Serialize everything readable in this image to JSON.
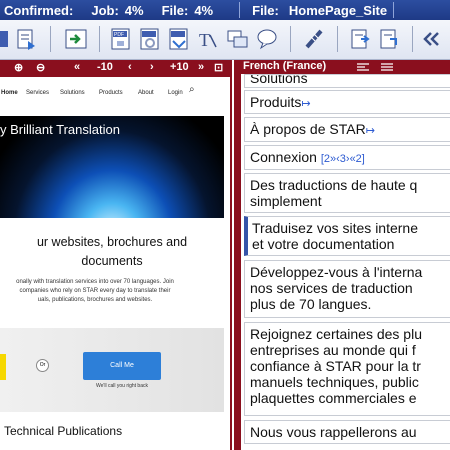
{
  "status": {
    "confirmed_label": "Confirmed:",
    "job_label": "Job:",
    "job_value": "4%",
    "file_label": "File:",
    "file_value": "4%",
    "file_name_label": "File:",
    "file_name": "HomePage_Site"
  },
  "toolbar": {
    "buttons": [
      "save-doc",
      "next-segment",
      "pdf-export",
      "pdf-refresh",
      "pdf-preview",
      "text-format",
      "copy-text",
      "comment",
      "ruler-tool",
      "confirm-next",
      "confirm-down",
      "rewind"
    ]
  },
  "preview": {
    "nav": {
      "zoom_in": "⊕",
      "zoom_out": "⊖",
      "first": "«",
      "minus10": "-10",
      "prev": "‹",
      "next": "›",
      "plus10": "+10",
      "last": "»",
      "fit": "⊡"
    },
    "site_nav": [
      "Home",
      "Services",
      "Solutions",
      "Products",
      "About",
      "Login"
    ],
    "hero_title": "y Brilliant Translation",
    "headline_1": "ur websites, brochures and",
    "headline_2": "documents",
    "body_line_1": "onally with translation services into over 70 languages. Join",
    "body_line_2": "companies who rely on STAR every day to translate their",
    "body_line_3": "uals, publications, brochures and websites.",
    "or_label": "Or",
    "call_button": "Call Me",
    "call_note": "We'll call you right back",
    "tech_pub": "Technical Publications"
  },
  "translation": {
    "language": "French (France)",
    "top_clip": "Solutions",
    "segments": [
      {
        "text": "Produits",
        "tag": "↦"
      },
      {
        "text": "À propos de STAR",
        "tag": "↦"
      },
      {
        "text": "Connexion",
        "tag": "[2»‹3›«2]"
      },
      {
        "text": "Des traductions de haute q",
        "line2": "simplement"
      },
      {
        "text": "Traduisez vos sites interne",
        "line2": "et votre documentation"
      },
      {
        "text": "Développez-vous à l'interna",
        "line2": "nos services de traduction",
        "line3": "plus de 70 langues."
      },
      {
        "text": "Rejoignez certaines des plu",
        "line2": "entreprises au monde qui f",
        "line3": "confiance à STAR pour la tr",
        "line4": "manuels techniques, public",
        "line5": "plaquettes commerciales e"
      },
      {
        "text": "Nous vous rappellerons au"
      }
    ]
  },
  "colors": {
    "accent": "#8a0f1e",
    "status_bar": "#2c4ea0",
    "active_segment": "#3554a8",
    "call_button": "#2d7fd8"
  }
}
